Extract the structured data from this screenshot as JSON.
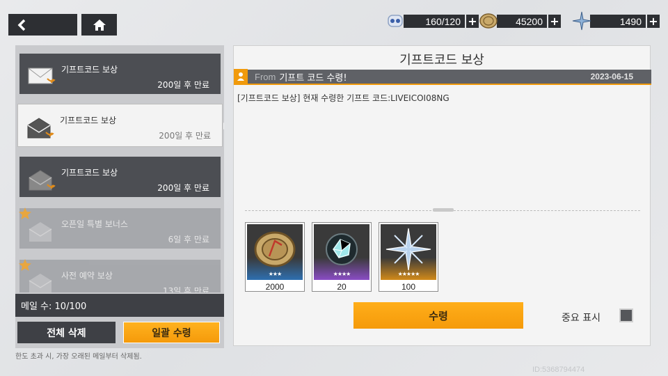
{
  "topbar": {
    "back_icon": "back-arrow-icon",
    "home_icon": "home-icon"
  },
  "resources": [
    {
      "icon": "stamina-icon",
      "value": "160/120"
    },
    {
      "icon": "coin-icon",
      "value": "45200"
    },
    {
      "icon": "crystal-icon",
      "value": "1490"
    }
  ],
  "mails": [
    {
      "title": "기프트코드 보상",
      "expire": "200일 후 만료",
      "state": "normal",
      "star": false
    },
    {
      "title": "기프트코드 보상",
      "expire": "200일 후 만료",
      "state": "selected",
      "star": false
    },
    {
      "title": "기프트코드 보상",
      "expire": "200일 후 만료",
      "state": "normal",
      "star": false
    },
    {
      "title": "오픈일 특별 보너스",
      "expire": "6일 후 만료",
      "state": "faded",
      "star": true
    },
    {
      "title": "사전 예약 보상",
      "expire": "13일 후 만료",
      "state": "faded",
      "star": true
    }
  ],
  "left": {
    "mail_count": "메일 수: 10/100",
    "delete_all": "전체 삭제",
    "claim_all": "일괄 수령",
    "footnote": "한도 초과 시, 가장 오래된 메일부터 삭제됨."
  },
  "detail": {
    "title": "기프트코드 보상",
    "from_label": "From",
    "from_name": "기프트 코드 수령!",
    "date": "2023-06-15",
    "body": "[기프트코드 보상] 현재 수령한 기프트 코드:LIVEICOI08NG",
    "rewards": [
      {
        "icon": "coin-icon",
        "stars": "★★★",
        "count": "2000",
        "tint": "#2e6fb0"
      },
      {
        "icon": "gem-shard-icon",
        "stars": "★★★★",
        "count": "20",
        "tint": "#8a4cc4"
      },
      {
        "icon": "crystal-icon",
        "stars": "★★★★★",
        "count": "100",
        "tint": "#d18a1a"
      }
    ],
    "claim": "수령",
    "important_label": "중요 표시"
  },
  "uid": "ID:5368794474",
  "colors": {
    "accent": "#f59a0a",
    "dark": "#2d2f33"
  }
}
